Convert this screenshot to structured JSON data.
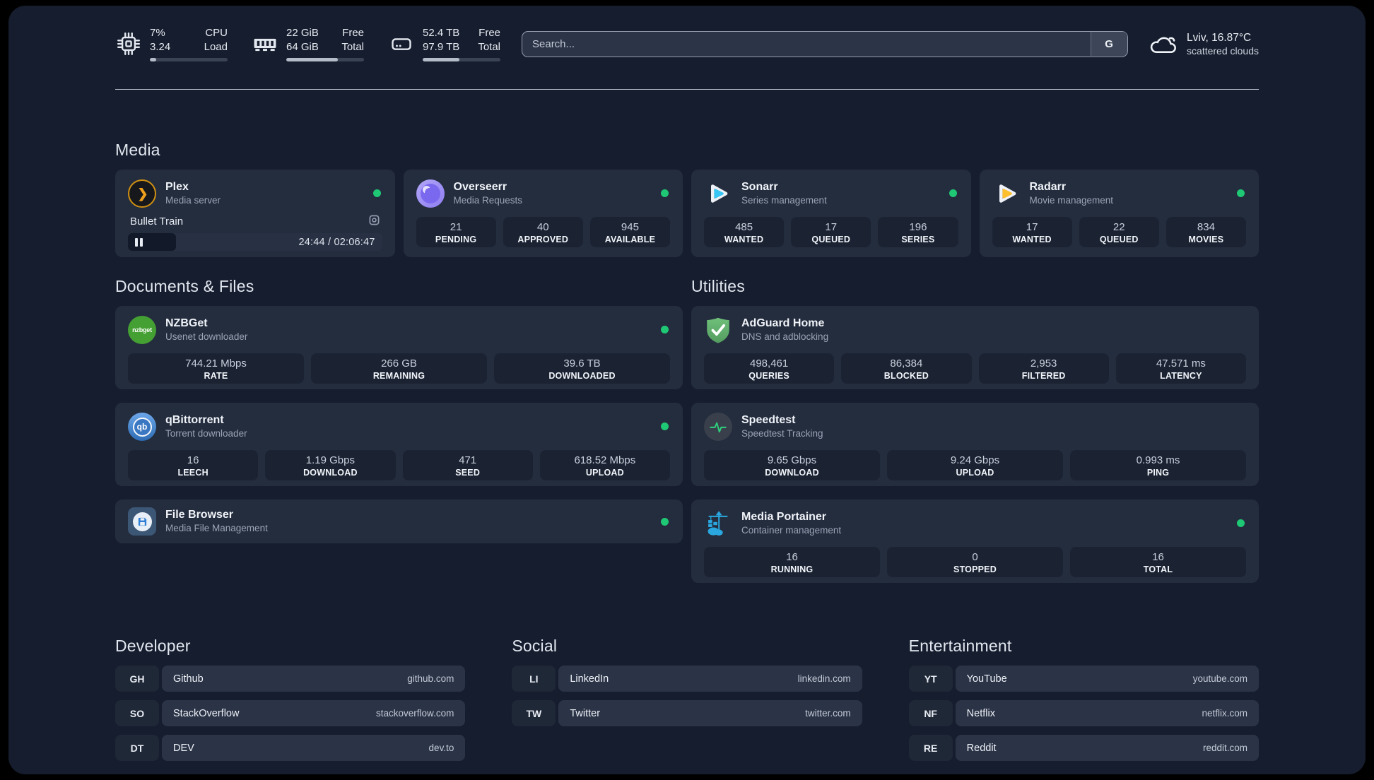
{
  "theme": {
    "status_online_color": "#1fc874"
  },
  "header": {
    "cpu": {
      "value_top": "7%",
      "value_bottom": "3.24",
      "label_top": "CPU",
      "label_bottom": "Load",
      "progress_pct": 8
    },
    "ram": {
      "value_top": "22 GiB",
      "value_bottom": "64 GiB",
      "label_top": "Free",
      "label_bottom": "Total",
      "progress_pct": 66
    },
    "disk": {
      "value_top": "52.4 TB",
      "value_bottom": "97.9 TB",
      "label_top": "Free",
      "label_bottom": "Total",
      "progress_pct": 47
    },
    "search": {
      "placeholder": "Search...",
      "provider_button": "G"
    },
    "weather": {
      "location_temp": "Lviv, 16.87°C",
      "condition": "scattered clouds"
    }
  },
  "media": {
    "section_title": "Media",
    "plex": {
      "name": "Plex",
      "subtitle": "Media server",
      "status": "online",
      "player": {
        "title": "Bullet Train",
        "time": "24:44 / 02:06:47",
        "progress_pct": 19
      }
    },
    "overseerr": {
      "name": "Overseerr",
      "subtitle": "Media Requests",
      "status": "online",
      "stats": [
        {
          "value": "21",
          "label": "PENDING"
        },
        {
          "value": "40",
          "label": "APPROVED"
        },
        {
          "value": "945",
          "label": "AVAILABLE"
        }
      ]
    },
    "sonarr": {
      "name": "Sonarr",
      "subtitle": "Series management",
      "status": "online",
      "stats": [
        {
          "value": "485",
          "label": "WANTED"
        },
        {
          "value": "17",
          "label": "QUEUED"
        },
        {
          "value": "196",
          "label": "SERIES"
        }
      ]
    },
    "radarr": {
      "name": "Radarr",
      "subtitle": "Movie management",
      "status": "online",
      "stats": [
        {
          "value": "17",
          "label": "WANTED"
        },
        {
          "value": "22",
          "label": "QUEUED"
        },
        {
          "value": "834",
          "label": "MOVIES"
        }
      ]
    }
  },
  "documents": {
    "section_title": "Documents & Files",
    "nzbget": {
      "name": "NZBGet",
      "subtitle": "Usenet downloader",
      "status": "online",
      "icon_text": "nzbget",
      "stats": [
        {
          "value": "744.21 Mbps",
          "label": "RATE"
        },
        {
          "value": "266 GB",
          "label": "REMAINING"
        },
        {
          "value": "39.6 TB",
          "label": "DOWNLOADED"
        }
      ]
    },
    "qbittorrent": {
      "name": "qBittorrent",
      "subtitle": "Torrent downloader",
      "status": "online",
      "icon_text": "qb",
      "stats": [
        {
          "value": "16",
          "label": "LEECH"
        },
        {
          "value": "1.19 Gbps",
          "label": "DOWNLOAD"
        },
        {
          "value": "471",
          "label": "SEED"
        },
        {
          "value": "618.52 Mbps",
          "label": "UPLOAD"
        }
      ]
    },
    "filebrowser": {
      "name": "File Browser",
      "subtitle": "Media File Management",
      "status": "online"
    }
  },
  "utilities": {
    "section_title": "Utilities",
    "adguard": {
      "name": "AdGuard Home",
      "subtitle": "DNS and adblocking",
      "stats": [
        {
          "value": "498,461",
          "label": "QUERIES"
        },
        {
          "value": "86,384",
          "label": "BLOCKED"
        },
        {
          "value": "2,953",
          "label": "FILTERED"
        },
        {
          "value": "47.571 ms",
          "label": "LATENCY"
        }
      ]
    },
    "speedtest": {
      "name": "Speedtest",
      "subtitle": "Speedtest Tracking",
      "stats": [
        {
          "value": "9.65 Gbps",
          "label": "DOWNLOAD"
        },
        {
          "value": "9.24 Gbps",
          "label": "UPLOAD"
        },
        {
          "value": "0.993 ms",
          "label": "PING"
        }
      ]
    },
    "portainer": {
      "name": "Media Portainer",
      "subtitle": "Container management",
      "status": "online",
      "stats": [
        {
          "value": "16",
          "label": "RUNNING"
        },
        {
          "value": "0",
          "label": "STOPPED"
        },
        {
          "value": "16",
          "label": "TOTAL"
        }
      ]
    }
  },
  "bookmarks": {
    "developer": {
      "section_title": "Developer",
      "items": [
        {
          "abbr": "GH",
          "name": "Github",
          "url": "github.com"
        },
        {
          "abbr": "SO",
          "name": "StackOverflow",
          "url": "stackoverflow.com"
        },
        {
          "abbr": "DT",
          "name": "DEV",
          "url": "dev.to"
        }
      ]
    },
    "social": {
      "section_title": "Social",
      "items": [
        {
          "abbr": "LI",
          "name": "LinkedIn",
          "url": "linkedin.com"
        },
        {
          "abbr": "TW",
          "name": "Twitter",
          "url": "twitter.com"
        }
      ]
    },
    "entertainment": {
      "section_title": "Entertainment",
      "items": [
        {
          "abbr": "YT",
          "name": "YouTube",
          "url": "youtube.com"
        },
        {
          "abbr": "NF",
          "name": "Netflix",
          "url": "netflix.com"
        },
        {
          "abbr": "RE",
          "name": "Reddit",
          "url": "reddit.com"
        }
      ]
    }
  }
}
